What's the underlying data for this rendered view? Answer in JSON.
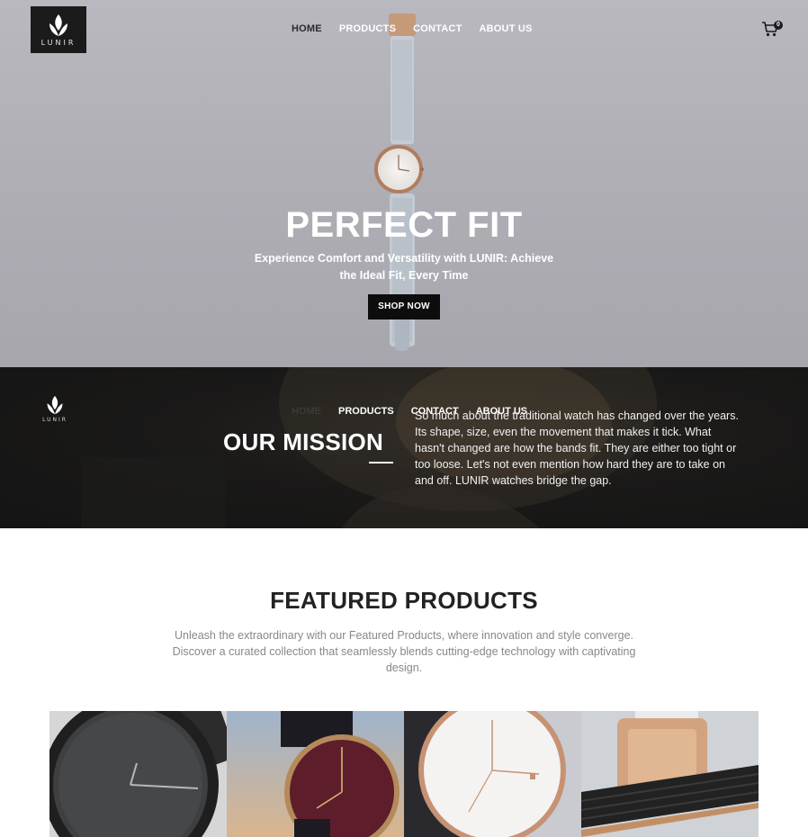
{
  "brand": {
    "name": "LUNIR"
  },
  "nav": {
    "items": [
      "HOME",
      "PRODUCTS",
      "CONTACT",
      "ABOUT US"
    ],
    "cart_count": "0"
  },
  "hero": {
    "title": "PERFECT FIT",
    "subtitle": "Experience Comfort and Versatility with LUNIR: Achieve the Ideal Fit, Every Time",
    "cta": "SHOP NOW"
  },
  "mission": {
    "nav": [
      "HOME",
      "PRODUCTS",
      "CONTACT",
      "ABOUT US"
    ],
    "title": "OUR MISSION",
    "text": "So much about the traditional watch has changed over the years. Its shape, size, even the movement that makes it tick. What hasn't changed are how the bands fit. They are either too tight or too loose. Let's not even mention how hard they are to take on and off. LUNIR watches bridge the gap."
  },
  "featured": {
    "title": "FEATURED PRODUCTS",
    "description": "Unleash the extraordinary with our Featured Products, where innovation and style converge. Discover a curated collection that seamlessly blends cutting-edge technology with captivating design.",
    "products": [
      {
        "name": "black-watch-image"
      },
      {
        "name": "burgundy-watch-image"
      },
      {
        "name": "white-rose-gold-watch-image"
      },
      {
        "name": "watch-band-clasp-image"
      }
    ]
  },
  "colors": {
    "accent": "#0d0d0d",
    "hero_bg": "#b1b0b7",
    "mission_bg": "#141414"
  }
}
